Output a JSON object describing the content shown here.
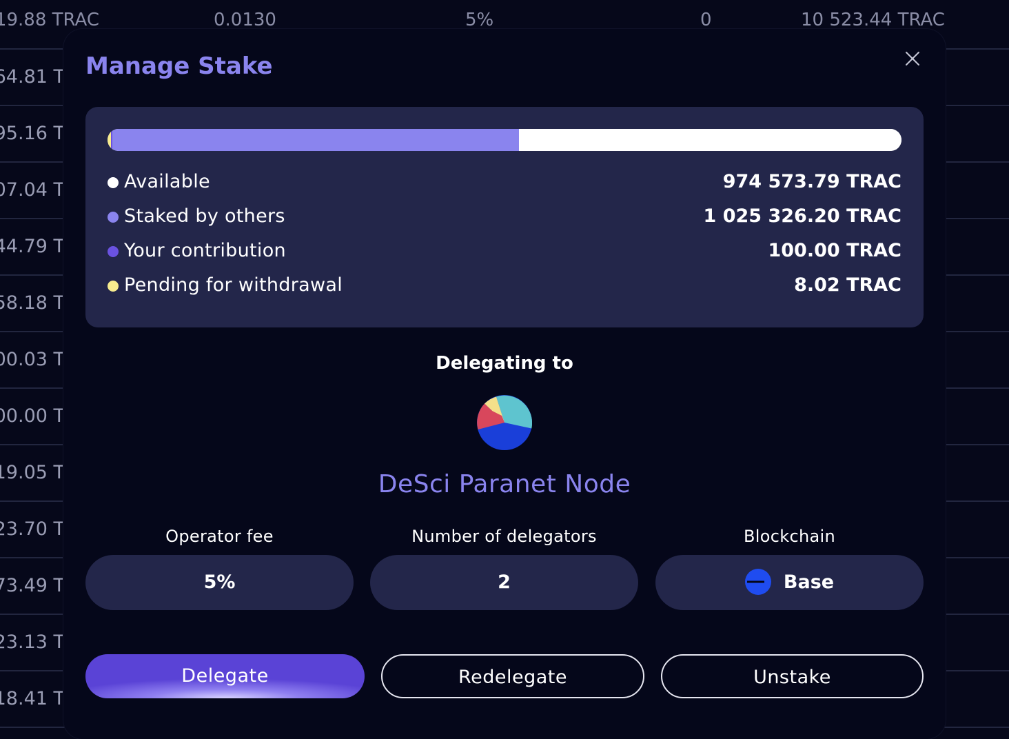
{
  "background_table": {
    "header": [
      "19.88 TRAC",
      "0.0130",
      "5%",
      "0",
      "10 523.44 TRAC"
    ],
    "rows": [
      "64.81 T",
      "95.16 T",
      "07.04 T",
      "44.79 T",
      "58.18 T",
      "00.03 T",
      "00.00 T",
      "19.05 T",
      "23.70 T",
      "73.49 T",
      "23.13 T",
      "18.41 T"
    ]
  },
  "modal": {
    "title": "Manage Stake",
    "close_icon": "close-icon",
    "stake_bar": {
      "segments": [
        {
          "name": "Pending for withdrawal",
          "color": "#f7ec8f",
          "fraction": 0.004
        },
        {
          "name": "Your contribution",
          "color": "#6a52e0",
          "fraction": 0.0025
        },
        {
          "name": "Staked by others",
          "color": "#8a84ee",
          "fraction": 0.512
        },
        {
          "name": "Available",
          "color": "#ffffff",
          "fraction": 0.4815
        }
      ]
    },
    "legend": [
      {
        "label": "Available",
        "value": "974 573.79 TRAC",
        "color": "#ffffff"
      },
      {
        "label": "Staked by others",
        "value": "1 025 326.20 TRAC",
        "color": "#8a84ee"
      },
      {
        "label": "Your contribution",
        "value": "100.00 TRAC",
        "color": "#6a52e0"
      },
      {
        "label": "Pending for withdrawal",
        "value": "8.02 TRAC",
        "color": "#f7ec8f"
      }
    ],
    "delegating_label": "Delegating to",
    "node": {
      "avatar_icon": "node-avatar-pie-icon",
      "name": "DeSci Paranet Node"
    },
    "info": {
      "operator_fee": {
        "label": "Operator fee",
        "value": "5%"
      },
      "delegators": {
        "label": "Number of delegators",
        "value": "2"
      },
      "blockchain": {
        "label": "Blockchain",
        "value": "Base",
        "icon": "base-chain-icon",
        "color": "#1f4cf0"
      }
    },
    "actions": {
      "delegate": "Delegate",
      "redelegate": "Redelegate",
      "unstake": "Unstake"
    },
    "colors": {
      "accent": "#8a84ee",
      "card": "#23264a",
      "modal_bg": "#05071a"
    }
  }
}
